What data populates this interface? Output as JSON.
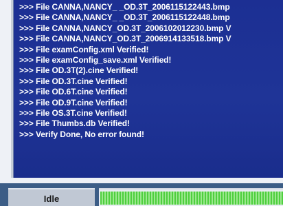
{
  "log": {
    "lines": [
      ">>> File CANNA,NANCY_ _OD.3T_2006115122443.bmp",
      ">>> File CANNA,NANCY_ _OD.3T_2006115122448.bmp",
      ">>> File CANNA,NANCY_OD.3T_2006102012230.bmp V",
      ">>> File CANNA,NANCY_OD.3T_2006914133518.bmp V",
      ">>> File examConfig.xml Verified!",
      ">>> File examConfig_save.xml Verified!",
      ">>> File OD.3T(2).cine Verified!",
      ">>> File OD.3T.cine Verified!",
      ">>> File OD.6T.cine Verified!",
      ">>> File OD.9T.cine Verified!",
      ">>> File OS.3T.cine Verified!",
      ">>> File Thumbs.db Verified!",
      ">>> Verify Done, No error found!"
    ]
  },
  "status": {
    "text": "Idle"
  },
  "progress": {
    "fraction": 1.0
  },
  "colors": {
    "log_background": "#1f3497",
    "log_text": "#ffffff",
    "progress_fill": "#4fcf3f"
  }
}
